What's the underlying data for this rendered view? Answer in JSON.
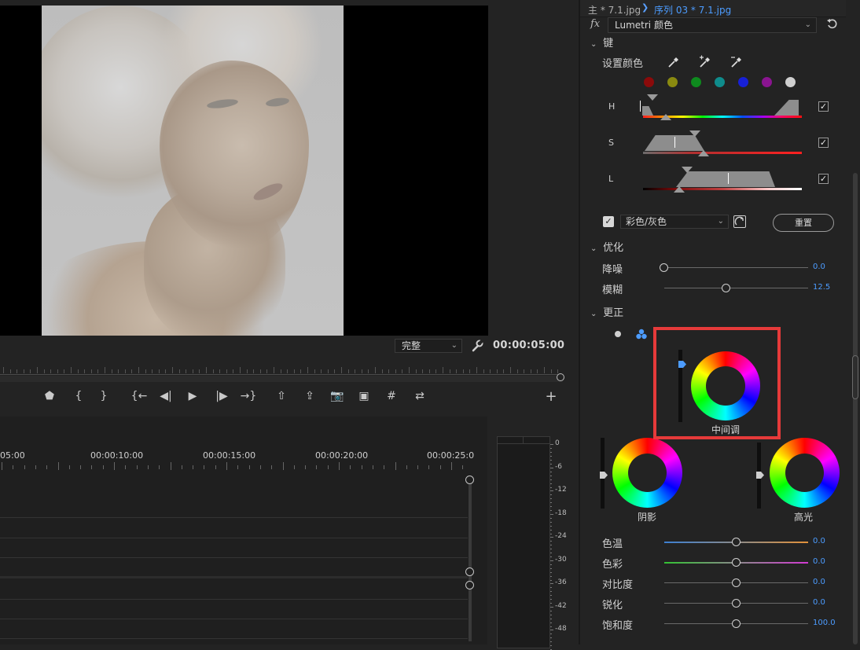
{
  "monitor": {
    "fit_option": "完整",
    "timecode": "00:00:05:00"
  },
  "transport": {
    "buttons": [
      {
        "name": "add-marker-button",
        "glyph": "⬟"
      },
      {
        "name": "mark-in-button",
        "glyph": "{"
      },
      {
        "name": "mark-out-button",
        "glyph": "}"
      },
      {
        "name": "go-to-in-button",
        "glyph": "{←"
      },
      {
        "name": "step-back-button",
        "glyph": "◀|"
      },
      {
        "name": "play-button",
        "glyph": "▶"
      },
      {
        "name": "step-forward-button",
        "glyph": "|▶"
      },
      {
        "name": "go-to-out-button",
        "glyph": "→}"
      },
      {
        "name": "lift-button",
        "glyph": "⇧"
      },
      {
        "name": "extract-button",
        "glyph": "⇪"
      },
      {
        "name": "export-frame-button",
        "glyph": "📷"
      },
      {
        "name": "comparison-view-button",
        "glyph": "▣"
      },
      {
        "name": "safe-margins-button",
        "glyph": "#"
      },
      {
        "name": "vr-video-button",
        "glyph": "⇄"
      },
      {
        "name": "add-button",
        "glyph": "+"
      }
    ]
  },
  "timeline": {
    "ruler_labels": [
      "05:00",
      "00:00:10:00",
      "00:00:15:00",
      "00:00:20:00",
      "00:00:25:0"
    ]
  },
  "meter": {
    "db_labels": [
      "0",
      "-6",
      "-12",
      "-18",
      "-24",
      "-30",
      "-36",
      "-42",
      "-48"
    ]
  },
  "panel": {
    "tab_master": "主 * 7.1.jpg",
    "tab_sequence": "序列 03 * 7.1.jpg",
    "fx_label": "fx",
    "effect_name": "Lumetri 颜色",
    "key_section": "键",
    "set_color_label": "设置颜色",
    "swatch_colors": [
      "#8b0a0a",
      "#8a8a10",
      "#0e8a1e",
      "#0f8c8c",
      "#1720d6",
      "#8a1490",
      "#cfcfcf"
    ],
    "hsl": [
      {
        "label": "H",
        "checked": "✓"
      },
      {
        "label": "S",
        "checked": "✓"
      },
      {
        "label": "L",
        "checked": "✓"
      }
    ],
    "mode_option": "彩色/灰色",
    "reset_label": "重置",
    "refine_section": "优化",
    "refine_params": [
      {
        "label": "降噪",
        "value": "0.0",
        "level": 0.0
      },
      {
        "label": "模糊",
        "value": "12.5",
        "level": 0.43
      }
    ],
    "correct_section": "更正",
    "wheels": {
      "midtones": "中间调",
      "shadows": "阴影",
      "highlights": "高光"
    },
    "correction_params": [
      {
        "label": "色温",
        "value": "0.0",
        "level": 0.5
      },
      {
        "label": "色彩",
        "value": "0.0",
        "level": 0.5
      },
      {
        "label": "对比度",
        "value": "0.0",
        "level": 0.5
      },
      {
        "label": "锐化",
        "value": "0.0",
        "level": 0.5
      },
      {
        "label": "饱和度",
        "value": "100.0",
        "level": 0.5
      }
    ],
    "accent_color": "#4c9cff",
    "highlight_color": "#e63a3a"
  }
}
